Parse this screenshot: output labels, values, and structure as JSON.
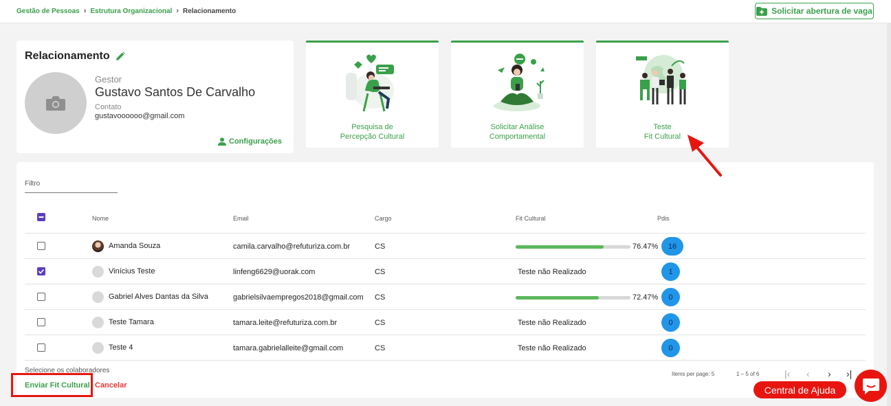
{
  "breadcrumb": {
    "items": [
      "Gestão de Pessoas",
      "Estrutura Organizacional"
    ],
    "current": "Relacionamento"
  },
  "top_action": {
    "label": "Solicitar abertura de vaga"
  },
  "profile": {
    "title": "Relacionamento",
    "gestor_label": "Gestor",
    "gestor_name": "Gustavo Santos De Carvalho",
    "contato_label": "Contato",
    "contato_value": "gustavoooooo@gmail.com",
    "config_label": "Configurações"
  },
  "features": [
    {
      "line1": "Pesquisa de",
      "line2": "Percepção Cultural"
    },
    {
      "line1": "Solicitar Análise",
      "line2": "Comportamental"
    },
    {
      "line1": "Teste",
      "line2": "Fit Cultural"
    }
  ],
  "filter": {
    "label": "Filtro"
  },
  "table": {
    "headers": {
      "nome": "Nome",
      "email": "Email",
      "cargo": "Cargo",
      "fit": "Fit Cultural",
      "pdis": "Pdis"
    },
    "rows": [
      {
        "name": "Amanda Souza",
        "email": "camila.carvalho@refuturiza.com.br",
        "cargo": "CS",
        "fit_percent": "76.47%",
        "fit_value": 76.47,
        "fit_text": "",
        "pdis": "16",
        "checked": false
      },
      {
        "name": "Vinícius Teste",
        "email": "linfeng6629@uorak.com",
        "cargo": "CS",
        "fit_percent": "",
        "fit_value": null,
        "fit_text": "Teste não Realizado",
        "pdis": "1",
        "checked": true
      },
      {
        "name": "Gabriel Alves Dantas da Silva",
        "email": "gabrielsilvaempregos2018@gmail.com",
        "cargo": "CS",
        "fit_percent": "72.47%",
        "fit_value": 72.47,
        "fit_text": "",
        "pdis": "0",
        "checked": false
      },
      {
        "name": "Teste Tamara",
        "email": "tamara.leite@refuturiza.com.br",
        "cargo": "CS",
        "fit_percent": "",
        "fit_value": null,
        "fit_text": "Teste não Realizado",
        "pdis": "0",
        "checked": false
      },
      {
        "name": "Teste 4",
        "email": "tamara.gabrielalleite@gmail.com",
        "cargo": "CS",
        "fit_percent": "",
        "fit_value": null,
        "fit_text": "Teste não Realizado",
        "pdis": "0",
        "checked": false
      }
    ]
  },
  "footer": {
    "select_hint": "Selecione os colaboradores",
    "send_label": "Enviar Fit Cultural",
    "cancel_label": "Cancelar"
  },
  "pager": {
    "items_per_page": "Items per page:  5",
    "range": "1 – 5 of 6"
  },
  "help": {
    "label": "Central de Ajuda"
  },
  "colors": {
    "brand_green": "#3aa04a",
    "accent_red": "#e8150f",
    "pdi_blue": "#2196e8",
    "checkbox_purple": "#5b3fbf"
  }
}
